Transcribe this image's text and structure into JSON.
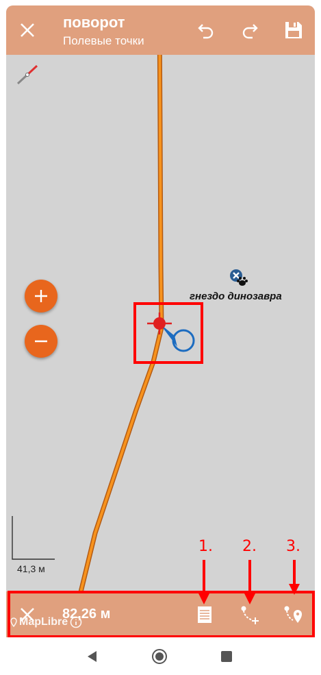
{
  "header": {
    "title": "поворот",
    "subtitle": "Полевые точки"
  },
  "map": {
    "poi_label": "гнездо динозавра",
    "scale_label": "41,3 м",
    "attribution": "MapLibre"
  },
  "bottom_bar": {
    "distance": "82,26 м"
  },
  "annotations": {
    "step1": "1.",
    "step2": "2.",
    "step3": "3."
  },
  "colors": {
    "toolbar": "#e0a07e",
    "accent": "#e8661d",
    "map_bg": "#d3d3d3",
    "highlight": "#ff0000"
  }
}
